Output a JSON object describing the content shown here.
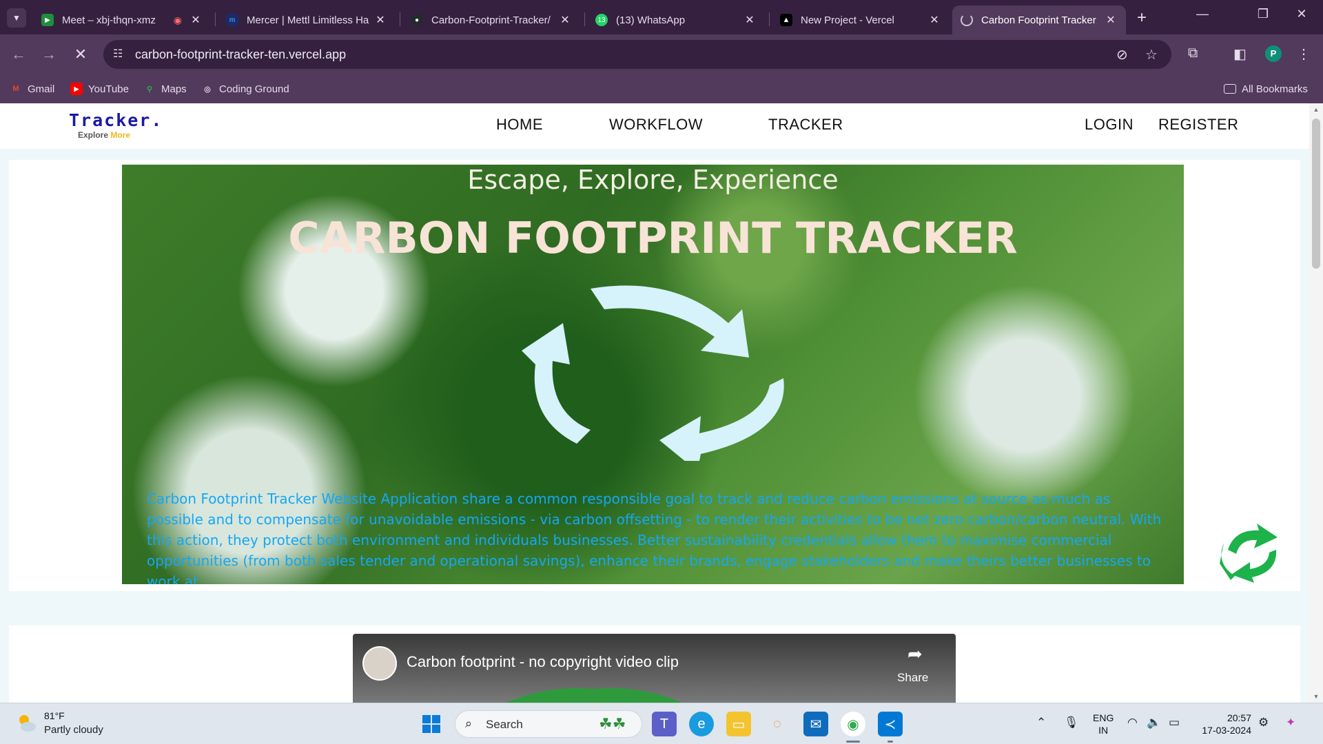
{
  "browser": {
    "tabs": [
      {
        "title": "Meet – xbj-thqn-xmz",
        "favicon": "google-meet-icon",
        "recording": true,
        "active": false
      },
      {
        "title": "Mercer | Mettl Limitless Ha",
        "favicon": "mercer-mettl-icon",
        "active": false
      },
      {
        "title": "Carbon-Footprint-Tracker/",
        "favicon": "github-icon",
        "active": false
      },
      {
        "title": "(13) WhatsApp",
        "favicon": "whatsapp-icon",
        "badge": "13",
        "active": false
      },
      {
        "title": "New Project - Vercel",
        "favicon": "vercel-icon",
        "active": false
      },
      {
        "title": "Carbon Footprint Tracker",
        "favicon": "loading-icon",
        "active": true
      }
    ],
    "url": "carbon-footprint-tracker-ten.vercel.app",
    "profile_initial": "P",
    "bookmarks": [
      {
        "label": "Gmail",
        "icon": "gmail-icon"
      },
      {
        "label": "YouTube",
        "icon": "youtube-icon"
      },
      {
        "label": "Maps",
        "icon": "maps-icon"
      },
      {
        "label": "Coding Ground",
        "icon": "globe-icon"
      }
    ],
    "all_bookmarks_label": "All Bookmarks"
  },
  "site": {
    "logo_title": "Tracker.",
    "logo_sub_a": "Explore",
    "logo_sub_b": "More",
    "nav": {
      "home": "HOME",
      "workflow": "WORKFLOW",
      "tracker": "TRACKER",
      "login": "LOGIN",
      "register": "REGISTER"
    },
    "hero": {
      "tagline": "Escape, Explore, Experience",
      "title": "CARBON FOOTPRINT TRACKER",
      "description": "Carbon Footprint Tracker Website Application share a common responsible goal to track and reduce carbon emissions at source as much as possible and to compensate for unavoidable emissions - via carbon offsetting - to render their activities to be net zero carbon/carbon neutral. With this action, they protect both environment and individuals businesses. Better sustainability credentials allow them to maximise commercial opportunities (from both sales tender and operational savings), enhance their brands, engage stakeholders and make theirs better businesses to work at."
    },
    "video": {
      "title": "Carbon footprint - no copyright video clip",
      "share_label": "Share"
    }
  },
  "taskbar": {
    "weather_temp": "81°F",
    "weather_desc": "Partly cloudy",
    "search_placeholder": "Search",
    "lang_line1": "ENG",
    "lang_line2": "IN",
    "time": "20:57",
    "date": "17-03-2024"
  },
  "colors": {
    "tabbar": "#35213f",
    "toolbar": "#523a5c",
    "hero_text": "#15a7f5",
    "logo": "#1a1aa6"
  }
}
